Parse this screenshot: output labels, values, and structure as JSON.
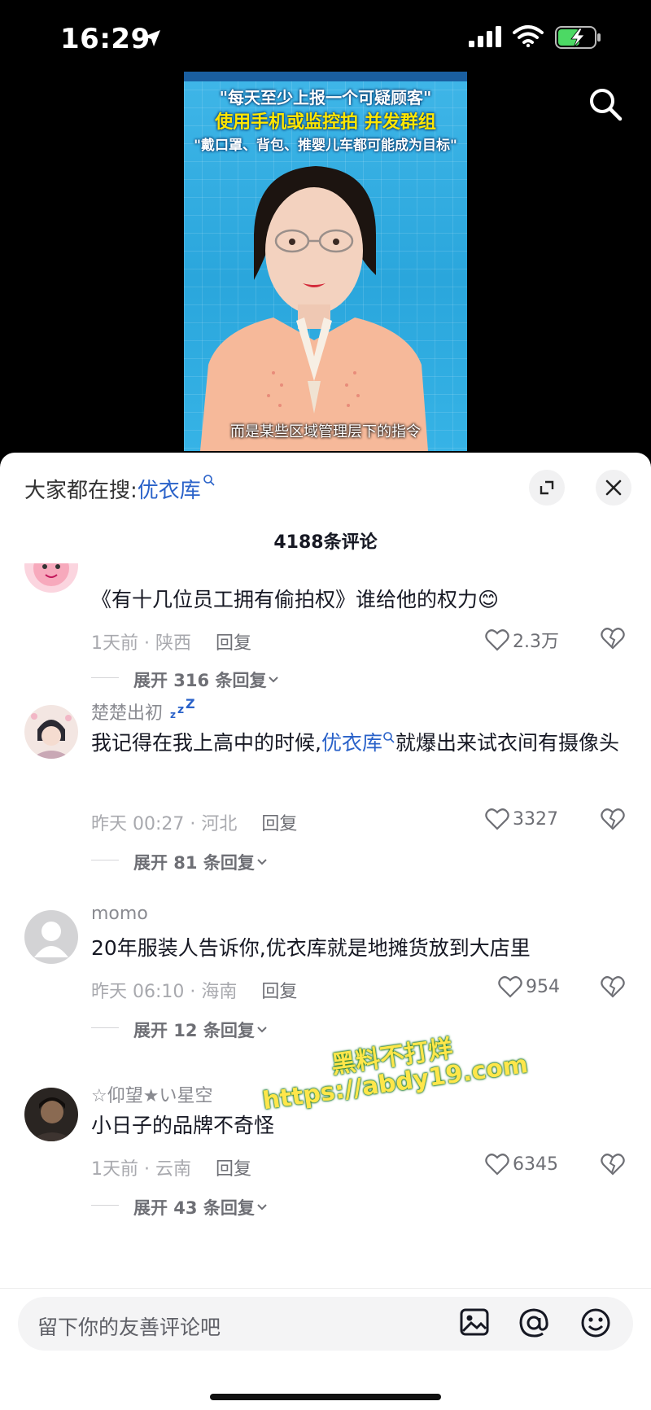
{
  "status_bar": {
    "time": "16:29"
  },
  "video": {
    "caption_top": "",
    "caption_line1": "\"每天至少上报一个可疑顾客\"",
    "caption_line2": "使用手机或监控拍 并发群组",
    "caption_line3": "\"戴口罩、背包、推婴儿车都可能成为目标\"",
    "subtitle": "而是某些区域管理层下的指令"
  },
  "sheet": {
    "trend_label": "大家都在搜:",
    "trend_keyword": "优衣库",
    "comment_count": "4188条评论"
  },
  "comments": [
    {
      "username": "",
      "text": "《有十几位员工拥有偷拍权》谁给他的权力😊",
      "time_location": "1天前 · 陕西",
      "reply": "回复",
      "likes": "2.3万",
      "expand": "展开 316 条回复"
    },
    {
      "username": "楚楚出初",
      "text_before": "我记得在我上高中的时候,",
      "keyword": "优衣库",
      "text_after": "就爆出来试衣间有摄像头",
      "time_location": "昨天 00:27 · 河北",
      "reply": "回复",
      "likes": "3327",
      "expand": "展开 81 条回复"
    },
    {
      "username": "momo",
      "text": "20年服装人告诉你,优衣库就是地摊货放到大店里",
      "time_location": "昨天 06:10 · 海南",
      "reply": "回复",
      "likes": "954",
      "expand": "展开 12 条回复"
    },
    {
      "username": "☆仰望★い星空",
      "text": "小日子的品牌不奇怪",
      "time_location": "1天前 · 云南",
      "reply": "回复",
      "likes": "6345",
      "expand": "展开 43 条回复"
    }
  ],
  "watermark": {
    "line1": "黑料不打烊",
    "line2": "https://abdy19.com"
  },
  "composer": {
    "placeholder": "留下你的友善评论吧"
  },
  "colors": {
    "keyword": "#2a62c9",
    "video_bg": "#2aa6dc"
  }
}
